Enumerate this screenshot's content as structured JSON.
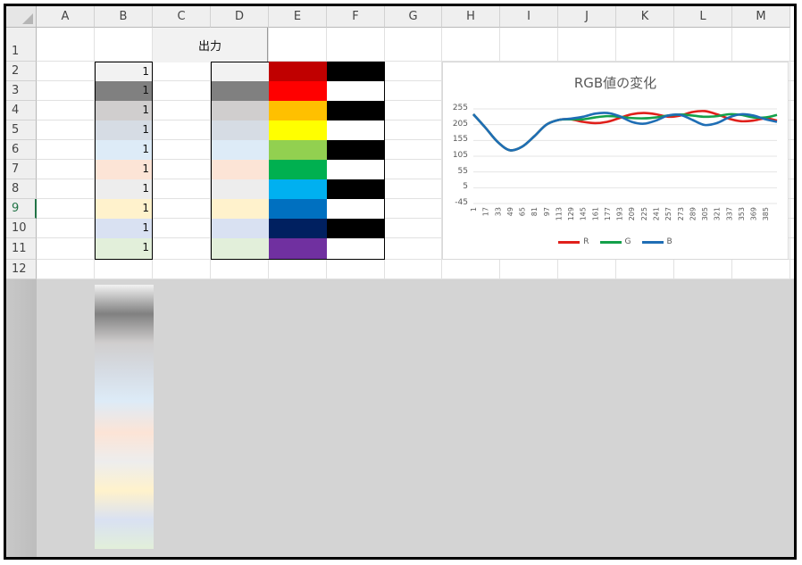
{
  "columns": [
    "A",
    "B",
    "C",
    "D",
    "E",
    "F",
    "G",
    "H",
    "I",
    "J",
    "K",
    "L",
    "M"
  ],
  "rows": [
    "1",
    "2",
    "3",
    "4",
    "5",
    "6",
    "7",
    "8",
    "9",
    "10",
    "11",
    "12"
  ],
  "selected_row": "9",
  "header_cell": "出力",
  "col_b_values": [
    "1",
    "1",
    "1",
    "1",
    "1",
    "1",
    "1",
    "1",
    "1",
    "1"
  ],
  "col_b_colors": [
    "#f2f2f2",
    "#808080",
    "#d0cece",
    "#d6dce4",
    "#ddebf7",
    "#fce4d6",
    "#ededed",
    "#fff2cc",
    "#d9e1f2",
    "#e2efda"
  ],
  "col_e_colors": [
    "#c00000",
    "#ff0000",
    "#ffc000",
    "#ffff00",
    "#92d050",
    "#00b050",
    "#00b0f0",
    "#0070c0",
    "#002060",
    "#7030a0"
  ],
  "col_f_colors": [
    "#000000",
    "#ffffff",
    "#000000",
    "#ffffff",
    "#000000",
    "#ffffff",
    "#000000",
    "#ffffff",
    "#000000",
    "#ffffff"
  ],
  "chart_data": {
    "type": "line",
    "title": "RGB値の変化",
    "xlabel": "",
    "ylabel": "",
    "ylim": [
      -45,
      255
    ],
    "yticks": [
      "255",
      "205",
      "155",
      "105",
      "55",
      "5",
      "-45"
    ],
    "x_ticks": [
      "1",
      "17",
      "33",
      "49",
      "65",
      "81",
      "97",
      "113",
      "129",
      "145",
      "161",
      "177",
      "193",
      "209",
      "225",
      "241",
      "257",
      "273",
      "289",
      "305",
      "321",
      "337",
      "353",
      "369",
      "385"
    ],
    "series": [
      {
        "name": "R",
        "color": "#e0201b",
        "x": [
          1,
          17,
          33,
          49,
          65,
          81,
          97,
          113,
          129,
          145,
          161,
          177,
          193,
          209,
          225,
          241,
          257,
          273,
          289,
          305,
          321,
          337,
          353,
          369,
          385,
          400
        ],
        "values": [
          238,
          195,
          150,
          124,
          135,
          168,
          205,
          220,
          222,
          214,
          210,
          214,
          226,
          238,
          242,
          238,
          230,
          234,
          245,
          248,
          238,
          224,
          216,
          218,
          225,
          218
        ]
      },
      {
        "name": "G",
        "color": "#14a04a",
        "x": [
          1,
          17,
          33,
          49,
          65,
          81,
          97,
          113,
          129,
          145,
          161,
          177,
          193,
          209,
          225,
          241,
          257,
          273,
          289,
          305,
          321,
          337,
          353,
          369,
          385,
          400
        ],
        "values": [
          238,
          195,
          150,
          124,
          135,
          168,
          205,
          220,
          222,
          222,
          228,
          232,
          230,
          226,
          225,
          228,
          234,
          237,
          234,
          230,
          232,
          238,
          236,
          228,
          228,
          236
        ]
      },
      {
        "name": "B",
        "color": "#1f6eb5",
        "x": [
          1,
          17,
          33,
          49,
          65,
          81,
          97,
          113,
          129,
          145,
          161,
          177,
          193,
          209,
          225,
          241,
          257,
          273,
          289,
          305,
          321,
          337,
          353,
          369,
          385,
          400
        ],
        "values": [
          238,
          195,
          150,
          124,
          135,
          168,
          205,
          220,
          224,
          230,
          240,
          242,
          232,
          214,
          208,
          218,
          234,
          236,
          220,
          204,
          210,
          228,
          238,
          234,
          222,
          214
        ]
      }
    ],
    "legend": "bottom",
    "grid": true
  }
}
